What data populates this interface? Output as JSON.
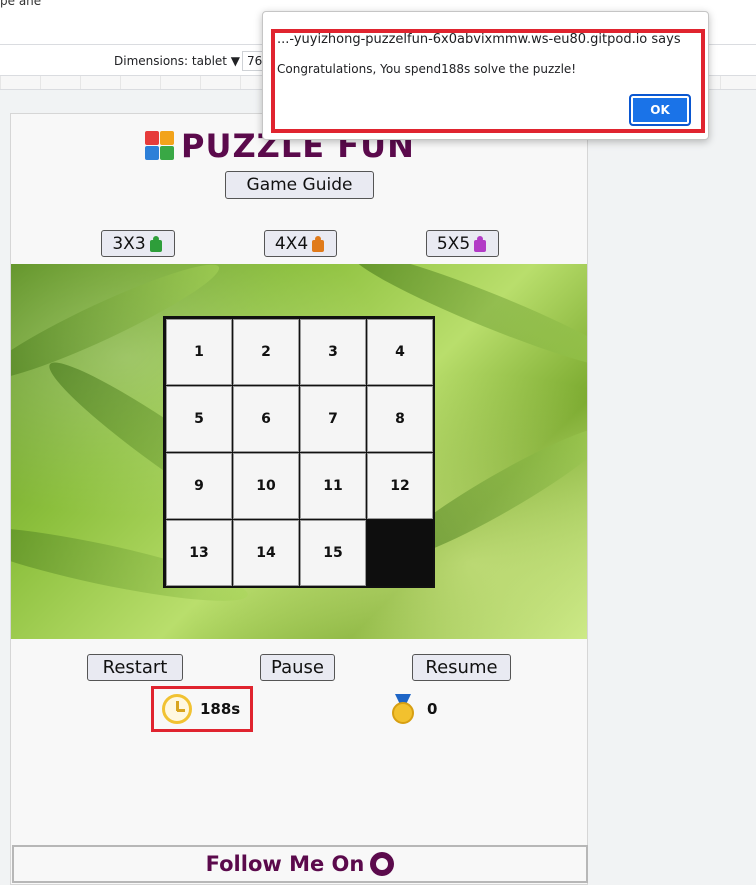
{
  "browser": {
    "top_cut_text": "pe ane",
    "dimensions_label": "Dimensions: tablet ▼",
    "width_value": "76"
  },
  "header": {
    "logo_text": "PUZZLE FUN",
    "guide_label": "Game Guide"
  },
  "levels": [
    {
      "label": "3X3",
      "piece_color": "#2e9e3a"
    },
    {
      "label": "4X4",
      "piece_color": "#e07a1a"
    },
    {
      "label": "5X5",
      "piece_color": "#b23bc6"
    }
  ],
  "board": {
    "tiles": [
      "1",
      "2",
      "3",
      "4",
      "5",
      "6",
      "7",
      "8",
      "9",
      "10",
      "11",
      "12",
      "13",
      "14",
      "15",
      ""
    ]
  },
  "controls": {
    "restart_label": "Restart",
    "pause_label": "Pause",
    "resume_label": "Resume"
  },
  "stats": {
    "time": "188s",
    "score": "0"
  },
  "footer": {
    "text": "Follow Me On"
  },
  "dialog": {
    "title": "...-yuyizhong-puzzelfun-6x0abvixmmw.ws-eu80.gitpod.io says",
    "message": "Congratulations, You spend188s solve the puzzle!",
    "ok_label": "OK"
  },
  "colors": {
    "brand": "#5b0a4c",
    "highlight": "#e0242f",
    "ok_button": "#1a73e8"
  }
}
